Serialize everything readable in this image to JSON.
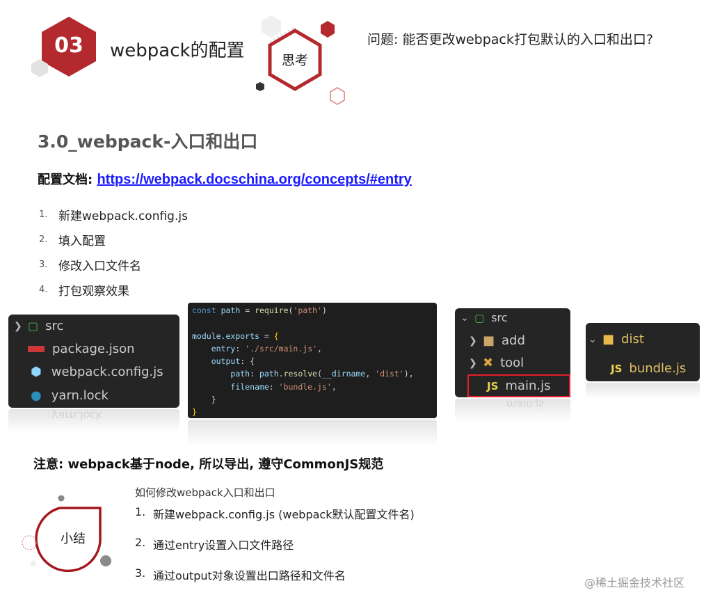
{
  "header": {
    "chapter_number": "03",
    "title": "webpack的配置",
    "think_label": "思考",
    "question": "问题: 能否更改webpack打包默认的入口和出口?"
  },
  "section": {
    "title": "3.0_webpack-入口和出口",
    "doc_label": "配置文档: ",
    "doc_link": "https://webpack.docschina.org/concepts/#entry"
  },
  "steps": [
    {
      "num": "1.",
      "text": "新建webpack.config.js"
    },
    {
      "num": "2.",
      "text": "填入配置"
    },
    {
      "num": "3.",
      "text": "修改入口文件名"
    },
    {
      "num": "4.",
      "text": "打包观察效果"
    }
  ],
  "explorer1": {
    "items": [
      "src",
      "package.json",
      "webpack.config.js",
      "yarn.lock"
    ],
    "reflection": "yarn.lock"
  },
  "code": {
    "lines": [
      "const path = require('path')",
      "",
      "module.exports = {",
      "    entry: './src/main.js',",
      "    output: {",
      "        path: path.resolve(__dirname, 'dist'),",
      "        filename: 'bundle.js',",
      "    }",
      "}"
    ]
  },
  "explorer2": {
    "items": [
      "src",
      "add",
      "tool",
      "main.js"
    ],
    "js_badge": "JS",
    "reflection": "main.js"
  },
  "explorer3": {
    "items": [
      "dist",
      "bundle.js"
    ],
    "js_badge": "JS"
  },
  "note": "注意: webpack基于node, 所以导出, 遵守CommonJS规范",
  "summary": {
    "label": "小结",
    "heading": "如何修改webpack入口和出口",
    "items": [
      {
        "num": "1.",
        "text": "新建webpack.config.js (webpack默认配置文件名)"
      },
      {
        "num": "2.",
        "text": "通过entry设置入口文件路径"
      },
      {
        "num": "3.",
        "text": "通过output对象设置出口路径和文件名"
      }
    ]
  },
  "watermark": "@稀土掘金技术社区",
  "colors": {
    "accent_red": "#b3292d",
    "link_blue": "#1a1aff",
    "panel_bg": "#252526"
  }
}
